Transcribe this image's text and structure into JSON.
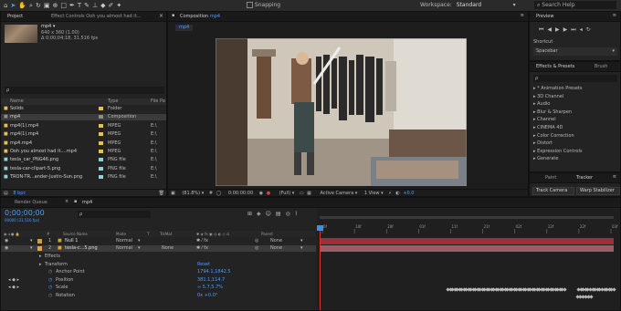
{
  "toolbar": {
    "snapping_label": "Snapping",
    "workspace_label": "Workspace:",
    "workspace_value": "Standard",
    "search_help_placeholder": "Search Help"
  },
  "project": {
    "tab_label": "Project",
    "effect_controls_tab": "Effect Controls Ooh you almost had it...",
    "selected_name": "mp4 ▾",
    "selected_info1": "640 x 360 (1.00)",
    "selected_info2": "Δ 0;00;04;18, 31.516 fps",
    "search_placeholder": "ρ",
    "columns": {
      "name": "Name",
      "type": "Type",
      "size": "File Pa"
    },
    "items": [
      {
        "name": "Solids",
        "type": "Folder",
        "size": "",
        "color": "#e8c04a",
        "icon": "folder-icon"
      },
      {
        "name": "mp4",
        "type": "Composition",
        "size": "",
        "color": "#8c8c8c",
        "icon": "composition-icon"
      },
      {
        "name": "mp4(1).mp4",
        "type": "MPEG",
        "size": "E:\\",
        "color": "#e8c04a",
        "icon": "video-file-icon"
      },
      {
        "name": "mp4(1).mp4",
        "type": "MPEG",
        "size": "E:\\",
        "color": "#e8c04a",
        "icon": "video-file-icon"
      },
      {
        "name": "mp4.mp4",
        "type": "MPEG",
        "size": "E:\\",
        "color": "#e8c04a",
        "icon": "video-file-icon"
      },
      {
        "name": "Ooh you almost had it....mp4",
        "type": "MPEG",
        "size": "E:\\",
        "color": "#e8c04a",
        "icon": "video-file-icon"
      },
      {
        "name": "tesla_car_PNG46.png",
        "type": "PNG file",
        "size": "E:\\",
        "color": "#8fd4d4",
        "icon": "image-file-icon"
      },
      {
        "name": "tesla-car-clipart-5.png",
        "type": "PNG file",
        "size": "E:\\",
        "color": "#8fd4d4",
        "icon": "image-file-icon"
      },
      {
        "name": "TRON-TR...ander-Justin-Sun.png",
        "type": "PNG file",
        "size": "E:\\",
        "color": "#8fd4d4",
        "icon": "image-file-icon"
      }
    ],
    "bpc_label": "8 bpc"
  },
  "composition": {
    "tab_label": "Composition",
    "comp_name": "mp4",
    "breadcrumb": "mp4",
    "zoom": "(81.8%)",
    "timecode": "0:00:00:00",
    "resolution": "(Full)",
    "camera": "Active Camera",
    "views": "1 View",
    "exposure": "+0.0"
  },
  "preview": {
    "tab_label": "Preview",
    "shortcut_label": "Shortcut",
    "shortcut_value": "Spacebar"
  },
  "effects": {
    "tab_label": "Effects & Presets",
    "brush_tab": "Brush",
    "search_placeholder": "ρ",
    "categories": [
      "▸ * Animation Presets",
      "▸ 3D Channel",
      "▸ Audio",
      "▸ Blur & Sharpen",
      "▸ Channel",
      "▸ CINEMA 4D",
      "▸ Color Correction",
      "▸ Distort",
      "▸ Expression Controls",
      "▸ Generate"
    ]
  },
  "tracker": {
    "paint_tab": "Paint",
    "tracker_tab": "Tracker",
    "track_camera": "Track Camera",
    "warp_stabilizer": "Warp Stabilizer"
  },
  "timeline": {
    "render_queue_tab": "Render Queue",
    "comp_tab": "mp4",
    "timecode": "0;00;00;00",
    "frame_info": "00000 (31.516 fps)",
    "columns": {
      "source": "Source Name",
      "mode": "Mode",
      "t": "T",
      "trkmat": "TrkMat",
      "parent": "Parent"
    },
    "layers": [
      {
        "num": "1",
        "name": "Null 1",
        "mode": "Normal",
        "trkmat": "",
        "parent": "None",
        "color": "#c9a23a"
      },
      {
        "num": "2",
        "name": "tesla-c...5.png",
        "mode": "Normal",
        "trkmat": "None",
        "parent": "None",
        "color": "#e8a23a"
      }
    ],
    "props": [
      {
        "name": "Effects",
        "value": ""
      },
      {
        "name": "Transform",
        "value": "Reset"
      },
      {
        "name": "Anchor Point",
        "value": "1794.1,1842.5"
      },
      {
        "name": "Position",
        "value": "381.1,114.7"
      },
      {
        "name": "Scale",
        "value": "∞ 5.7,5.7%"
      },
      {
        "name": "Rotation",
        "value": "0x +0.0°"
      }
    ],
    "ruler_labels": [
      "0f",
      "10f",
      "20f",
      "01f",
      "11f",
      "21f",
      "02f",
      "12f",
      "22f",
      "03f"
    ]
  },
  "colors": {
    "panel_bg": "#232323",
    "accent_blue": "#2d8ceb",
    "layer_bar_red": "#9c2f3c",
    "layer_bar_pink": "#a25a66"
  }
}
